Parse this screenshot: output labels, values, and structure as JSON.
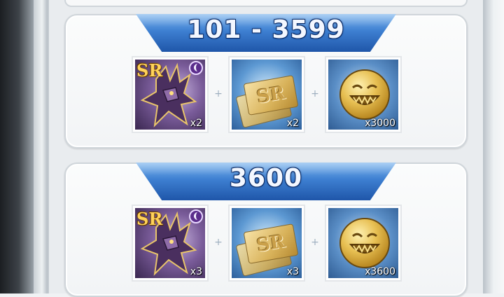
{
  "cards": [
    {
      "rank_range": "101 - 3599",
      "rewards": [
        {
          "type": "character",
          "rarity": "SR",
          "element_icon": "moon-dark-element-icon",
          "quantity": "x2"
        },
        {
          "type": "ticket",
          "label": "SR",
          "quantity": "x2"
        },
        {
          "type": "coin",
          "quantity": "x3000"
        }
      ]
    },
    {
      "rank_range": "3600",
      "rewards": [
        {
          "type": "character",
          "rarity": "SR",
          "element_icon": "moon-dark-element-icon",
          "quantity": "x3"
        },
        {
          "type": "ticket",
          "label": "SR",
          "quantity": "x3"
        },
        {
          "type": "coin",
          "quantity": "x3600"
        }
      ]
    }
  ],
  "colors": {
    "banner_blue": "#2f6fc4",
    "sr_gold": "#ffd25a",
    "dark_element_purple": "#5b2d8c"
  },
  "icons": {
    "plus_separator": "+",
    "coin_face": "ʘʘ"
  }
}
